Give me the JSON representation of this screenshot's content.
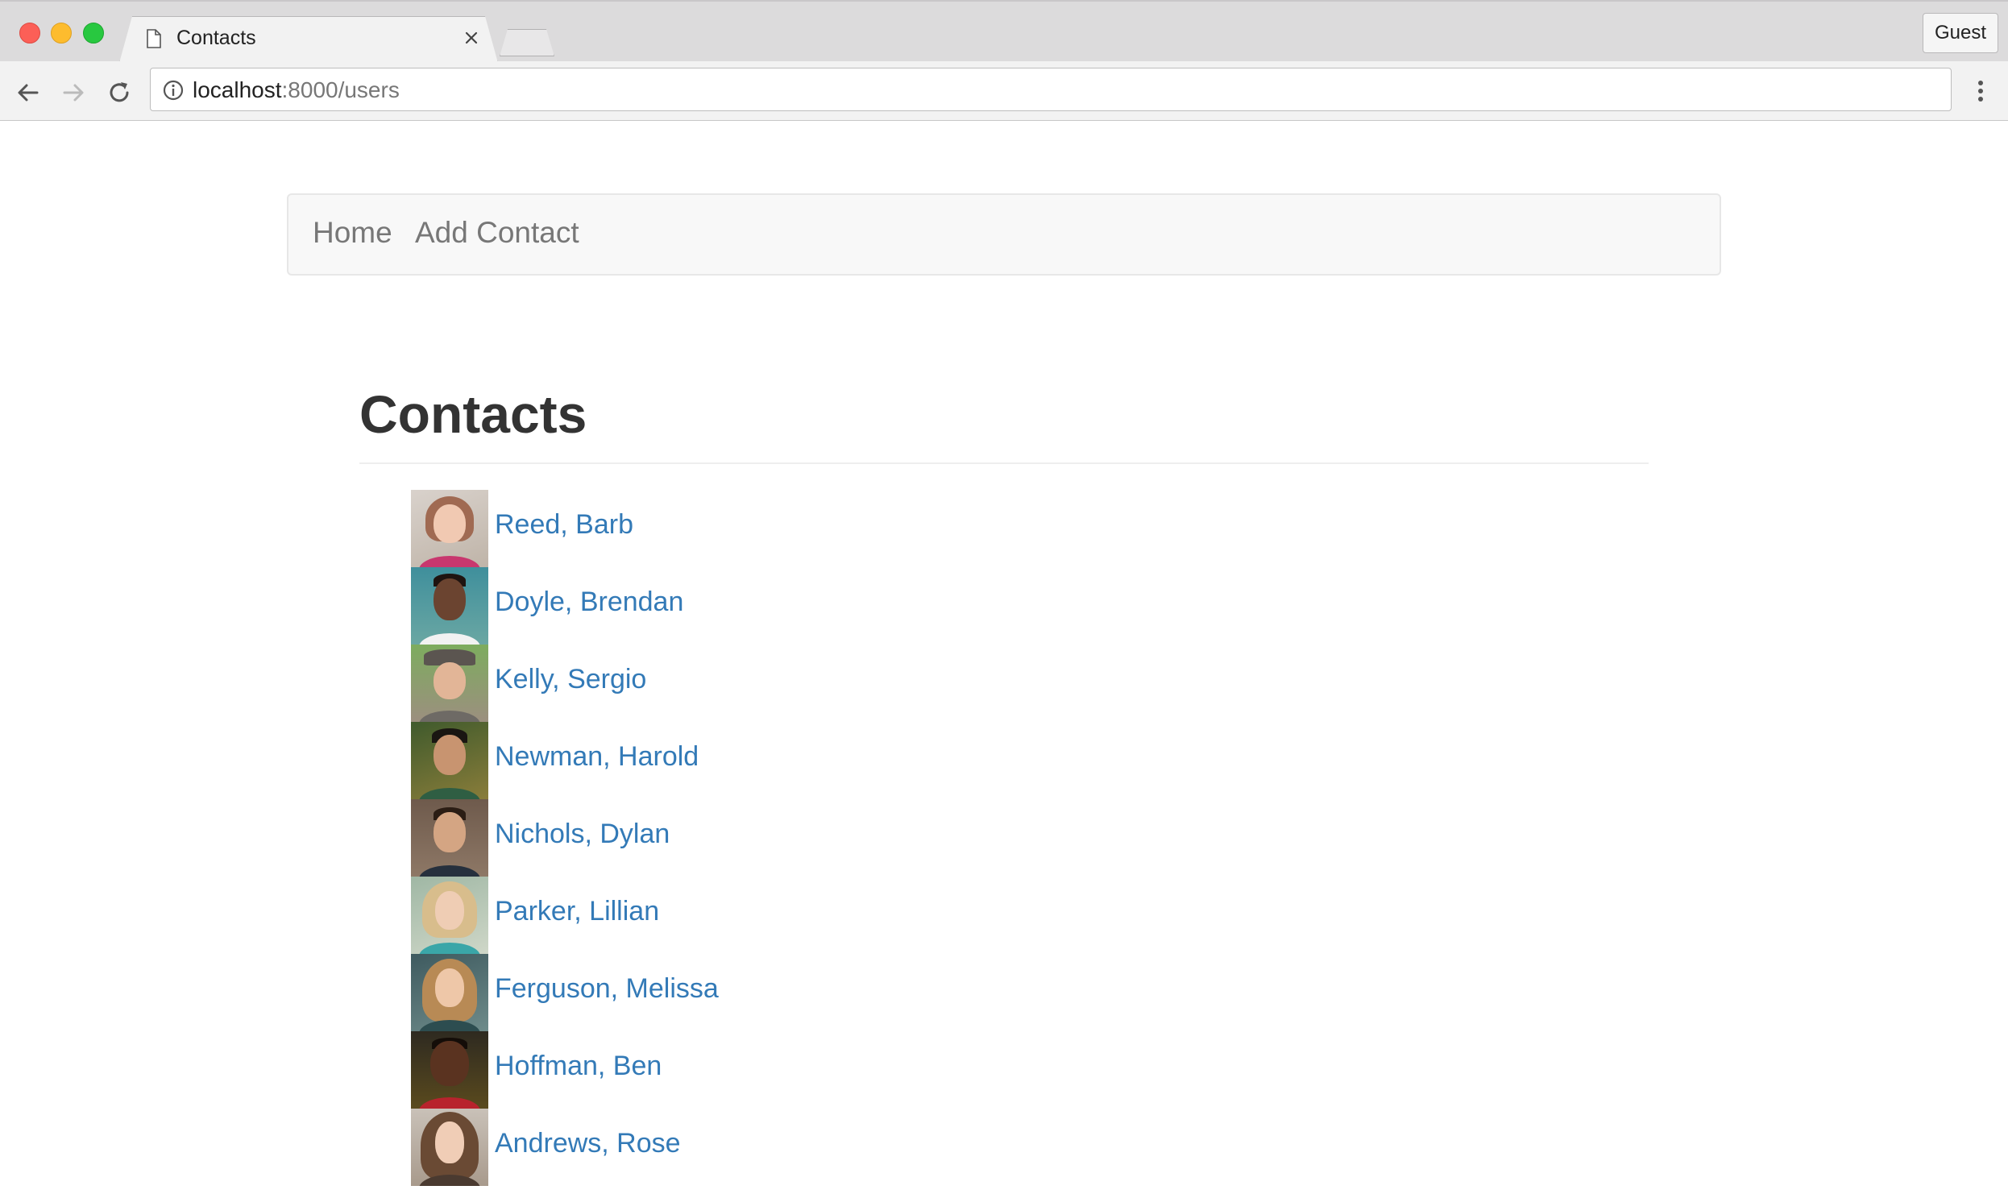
{
  "browser": {
    "tab_title": "Contacts",
    "profile_label": "Guest",
    "url_host": "localhost",
    "url_rest": ":8000/users"
  },
  "navbar": {
    "home_label": "Home",
    "add_contact_label": "Add Contact"
  },
  "page": {
    "heading": "Contacts"
  },
  "contacts": [
    {
      "name": "Reed, Barb"
    },
    {
      "name": "Doyle, Brendan"
    },
    {
      "name": "Kelly, Sergio"
    },
    {
      "name": "Newman, Harold"
    },
    {
      "name": "Nichols, Dylan"
    },
    {
      "name": "Parker, Lillian"
    },
    {
      "name": "Ferguson, Melissa"
    },
    {
      "name": "Hoffman, Ben"
    },
    {
      "name": "Andrews, Rose"
    }
  ],
  "colors": {
    "link": "#337ab7",
    "nav_text": "#777777",
    "heading": "#333333"
  },
  "icons": [
    "page-icon",
    "close-icon",
    "back-arrow-icon",
    "forward-arrow-icon",
    "reload-icon",
    "info-icon",
    "menu-dots-icon"
  ]
}
